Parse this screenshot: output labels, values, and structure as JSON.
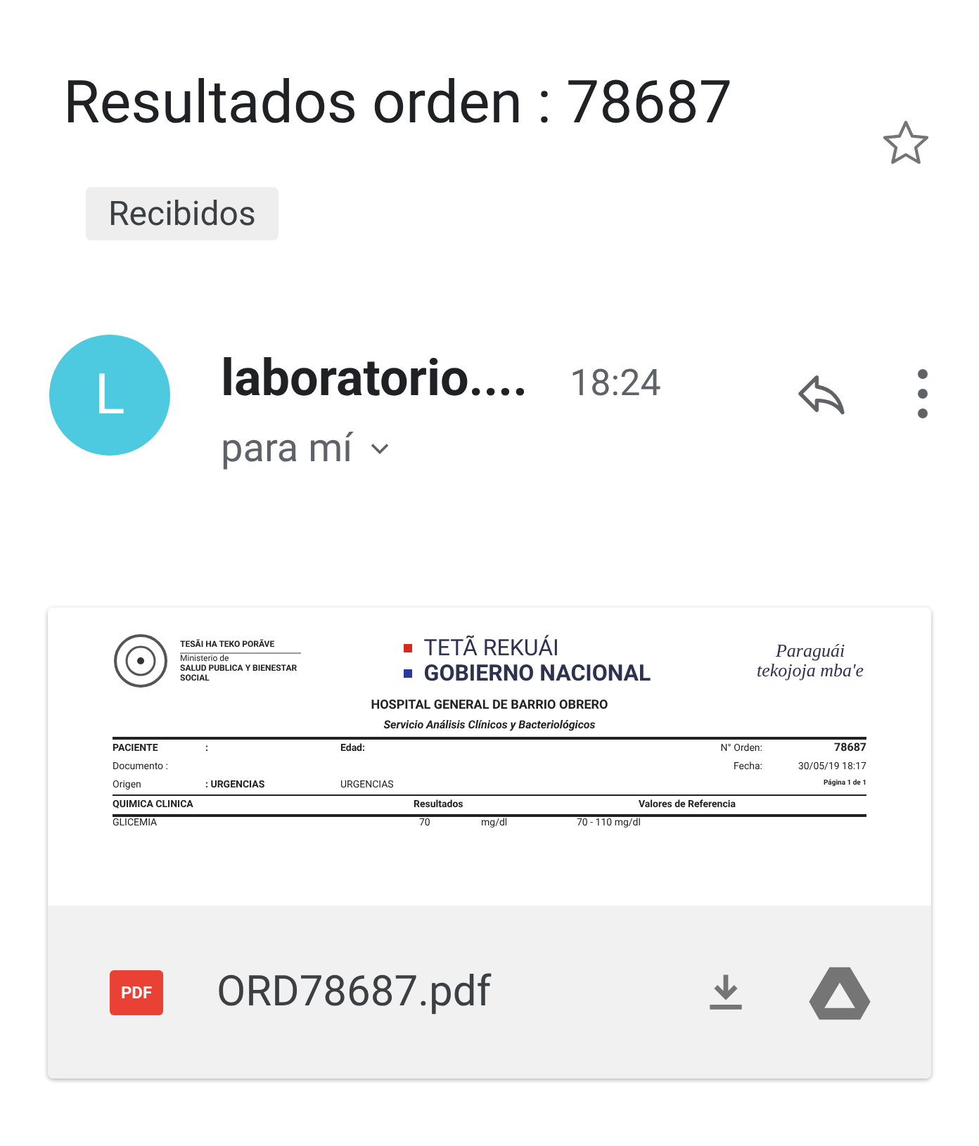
{
  "subject": {
    "title": "Resultados orden : 78687",
    "label": "Recibidos",
    "starred": false
  },
  "message": {
    "avatar_letter": "L",
    "sender": "laboratorio....",
    "time": "18:24",
    "recipient": "para mí"
  },
  "attachment": {
    "preview": {
      "ministry_motto": "TESÃI HA TEKO PORÃVE",
      "ministry_line": "Ministerio de",
      "ministry_name": "SALUD PUBLICA Y BIENESTAR SOCIAL",
      "gov_line_1": "TETÃ REKUÁI",
      "gov_line_2": "GOBIERNO NACIONAL",
      "slogan": "Paraguái tekojoja mba'e",
      "hospital": "HOSPITAL GENERAL DE BARRIO OBRERO",
      "service": "Servicio Análisis Clínicos y Bacteriológicos",
      "fields": [
        {
          "label": "PACIENTE",
          "value": ":",
          "col2": "Edad:",
          "col3_label": "N° Orden:",
          "col3_value": "78687"
        },
        {
          "label": "Documento :",
          "col3_label": "Fecha:",
          "col3_value": "30/05/19 18:17"
        },
        {
          "label": "Origen",
          "value": ": URGENCIAS",
          "col2": "URGENCIAS",
          "col3_value": "Página 1 de 1"
        }
      ],
      "section": "QUIMICA CLINICA",
      "results_header": "Resultados",
      "reference_header": "Valores de Referencia",
      "rows": [
        {
          "test": "GLICEMIA",
          "result": "70",
          "unit": "mg/dl",
          "reference": "70 - 110 mg/dl"
        }
      ]
    },
    "file_type": "PDF",
    "file_name": "ORD78687.pdf"
  }
}
